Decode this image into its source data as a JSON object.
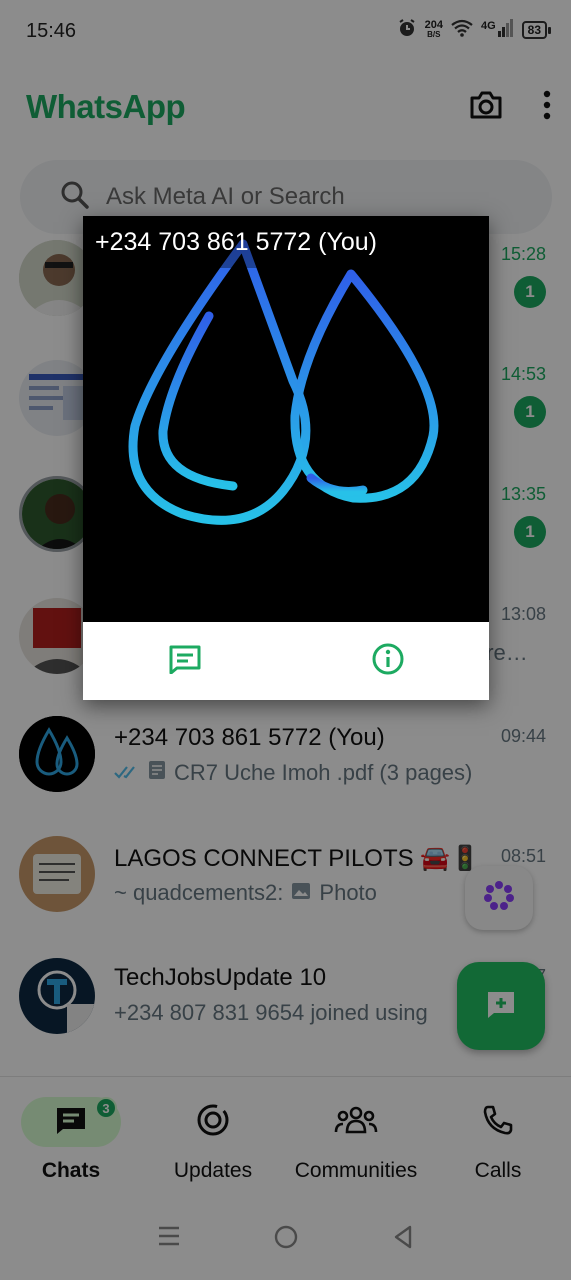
{
  "status": {
    "time": "15:46",
    "net_speed": "204",
    "net_unit": "B/S",
    "network": "4G",
    "battery": "83"
  },
  "header": {
    "title": "WhatsApp",
    "icons": [
      "camera-icon",
      "more-options-icon"
    ]
  },
  "search": {
    "placeholder": "Ask Meta AI or Search"
  },
  "chats": [
    {
      "time": "15:28",
      "unread": "1"
    },
    {
      "time": "14:53",
      "unread": "1"
    },
    {
      "time": "13:35",
      "unread": "1"
    },
    {
      "time": "13:08",
      "preview": "ere…"
    },
    {
      "name": "+234 703 861 5772 (You)",
      "time": "09:44",
      "preview": "CR7 Uche Imoh .pdf (3 pages)"
    },
    {
      "name": "LAGOS CONNECT PILOTS 🚘🚦",
      "time": "08:51",
      "preview_sender": "~ quadcements2:",
      "preview": "Photo"
    },
    {
      "name": "TechJobsUpdate 10",
      "time": "7",
      "preview": "+234 807 831 9654 joined using"
    }
  ],
  "bottom_nav": {
    "items": [
      {
        "label": "Chats",
        "badge": "3",
        "active": true
      },
      {
        "label": "Updates"
      },
      {
        "label": "Communities"
      },
      {
        "label": "Calls"
      }
    ]
  },
  "popup": {
    "title": "+234 703 861 5772 (You)",
    "actions": [
      "message-icon",
      "info-icon"
    ]
  },
  "colors": {
    "brand_green": "#1daa61",
    "fab_green": "#21c063",
    "active_pill": "#d8fdd2"
  }
}
